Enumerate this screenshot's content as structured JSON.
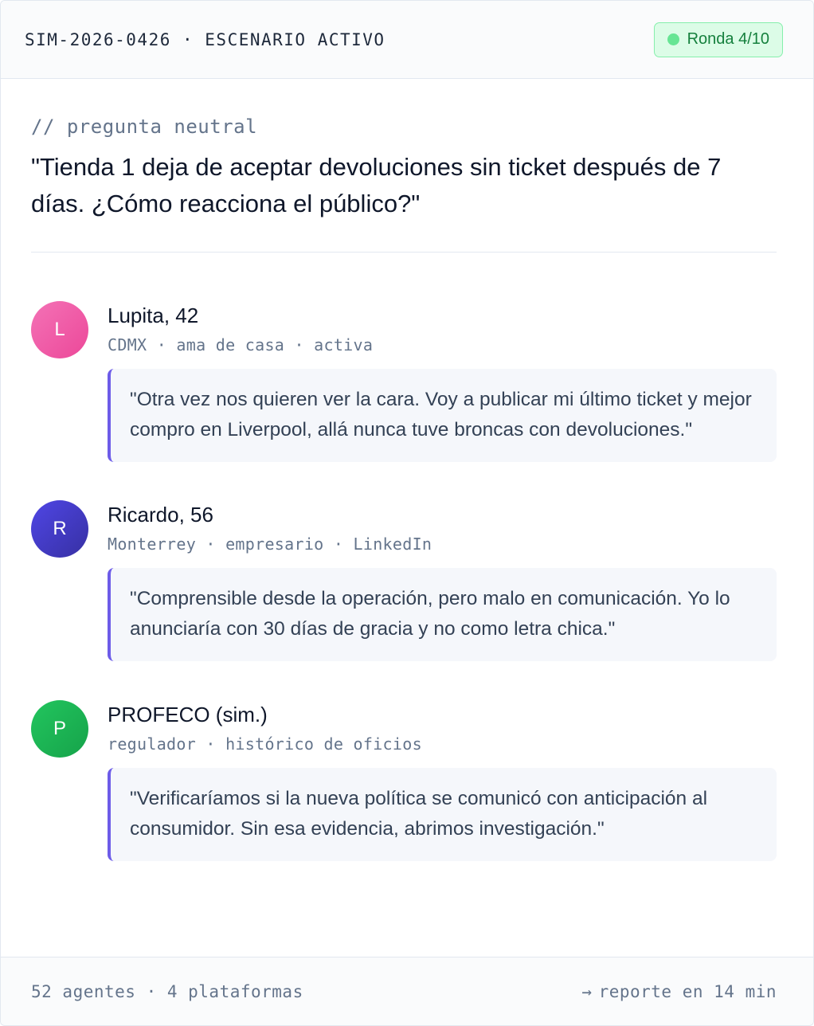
{
  "header": {
    "title": "SIM-2026-0426 · ESCENARIO ACTIVO",
    "badge": "Ronda 4/10",
    "badge_color": "#15803d"
  },
  "question": {
    "label": "// pregunta neutral",
    "text": "\"Tienda 1 deja de aceptar devoluciones sin ticket después de 7 días. ¿Cómo reacciona el público?\""
  },
  "responses": [
    {
      "initial": "L",
      "name": "Lupita, 42",
      "meta": "CDMX · ama de casa · activa",
      "quote": "\"Otra vez nos quieren ver la cara. Voy a publicar mi último ticket y mejor compro en Liverpool, allá nunca tuve broncas con devoluciones.\"",
      "avatar_color": "#ec4899"
    },
    {
      "initial": "R",
      "name": "Ricardo, 56",
      "meta": "Monterrey · empresario · LinkedIn",
      "quote": "\"Comprensible desde la operación, pero malo en comunicación. Yo lo anunciaría con 30 días de gracia y no como letra chica.\"",
      "avatar_color": "#3730a3"
    },
    {
      "initial": "P",
      "name": "PROFECO (sim.)",
      "meta": "regulador · histórico de oficios",
      "quote": "\"Verificaríamos si la nueva política se comunicó con anticipación al consumidor. Sin esa evidencia, abrimos investigación.\"",
      "avatar_color": "#16a34a"
    }
  ],
  "footer": {
    "left": "52 agentes · 4 plataformas",
    "arrow": "→",
    "right": "reporte en 14 min"
  },
  "colors": {
    "accent_border": "#6d5ce8"
  }
}
